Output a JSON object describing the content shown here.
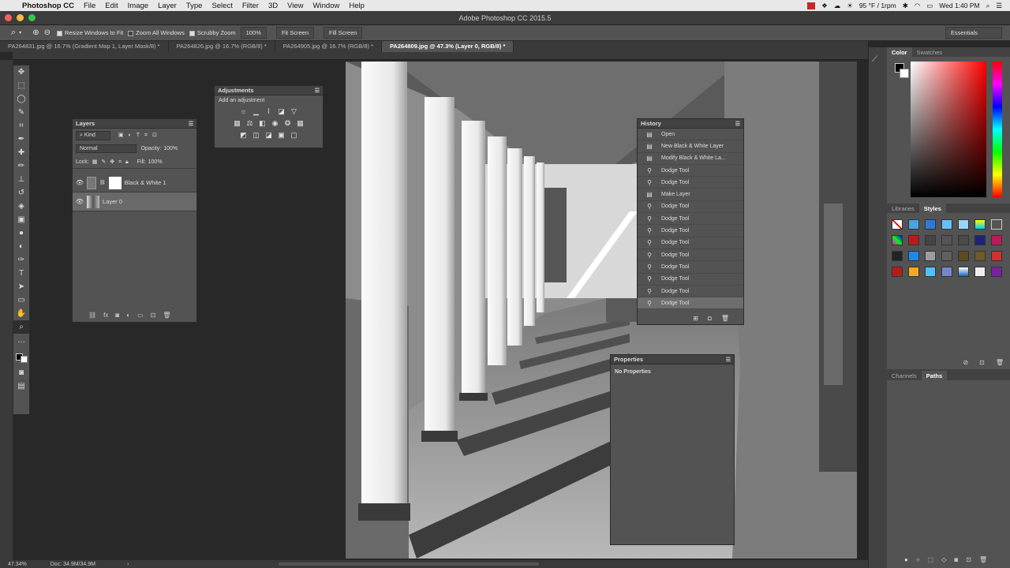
{
  "menubar": {
    "app": "Photoshop CC",
    "items": [
      "File",
      "Edit",
      "Image",
      "Layer",
      "Type",
      "Select",
      "Filter",
      "3D",
      "View",
      "Window",
      "Help"
    ],
    "weather": "95 °F / 1rpm",
    "clock": "Wed 1:40 PM"
  },
  "window": {
    "title": "Adobe Photoshop CC 2015.5"
  },
  "options": {
    "resize_windows": "Resize Windows to Fit",
    "zoom_all": "Zoom All Windows",
    "scrubby": "Scrubby Zoom",
    "zoom_pct": "100%",
    "fit_screen": "Fit Screen",
    "fill_screen": "Fill Screen",
    "workspace": "Essentials"
  },
  "tabs": [
    "PA264831.jpg @ 16.7% (Gradient Map 1, Layer Mask/8) *",
    "PA264826.jpg @ 16.7% (RGB/8) *",
    "PA264905.jpg @ 16.7% (RGB/8) *",
    "PA264809.jpg @ 47.3% (Layer 0, RGB/8) *"
  ],
  "layers": {
    "title": "Layers",
    "kind": "Kind",
    "blend": "Normal",
    "opacity_label": "Opacity:",
    "opacity": "100%",
    "lock_label": "Lock:",
    "fill_label": "Fill:",
    "fill": "100%",
    "rows": [
      "Black & White 1",
      "Layer 0"
    ]
  },
  "adjustments": {
    "title": "Adjustments",
    "subtitle": "Add an adjustment"
  },
  "history": {
    "title": "History",
    "items": [
      "Open",
      "New Black & White Layer",
      "Modify Black & White La...",
      "Dodge Tool",
      "Dodge Tool",
      "Make Layer",
      "Dodge Tool",
      "Dodge Tool",
      "Dodge Tool",
      "Dodge Tool",
      "Dodge Tool",
      "Dodge Tool",
      "Dodge Tool",
      "Dodge Tool",
      "Dodge Tool"
    ]
  },
  "properties": {
    "title": "Properties",
    "body": "No Properties"
  },
  "color_tabs": [
    "Color",
    "Swatches"
  ],
  "styles_tabs": [
    "Libraries",
    "Styles"
  ],
  "paths_tabs": [
    "Channels",
    "Paths"
  ],
  "status": {
    "zoom": "47.34%",
    "doc": "Doc: 34.9M/34.9M"
  }
}
